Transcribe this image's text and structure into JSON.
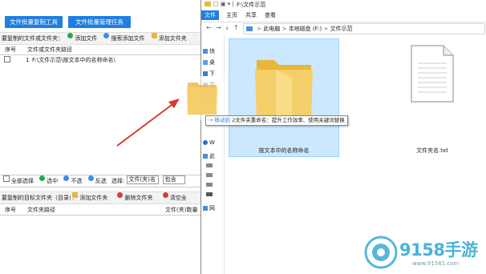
{
  "left_app": {
    "title_fragment": "",
    "top_buttons": [
      "文件批量复制工具",
      "文件批量管理任务"
    ],
    "source_toolbar": {
      "label": "要复制的文件或文件夹：",
      "add_file": "添加文件",
      "search_add_file": "搜索添加文件",
      "add_folder": "添加文件夹",
      "cut": "×"
    },
    "source_table": {
      "headers": [
        "序号",
        "文件或文件夹路径"
      ],
      "rows": [
        {
          "index": "1",
          "path": "F:\\文件示范\\按文本中的名称命名\\"
        }
      ]
    },
    "select_toolbar": {
      "select_all": "全部选择",
      "select": "选中",
      "deselect": "不选",
      "invert": "反选",
      "select_label": "选择:",
      "type_value": "文件(夹)名",
      "contains_value": "包含"
    },
    "target_toolbar": {
      "label": "要复制的目标文件夹（目录）：",
      "add_folder": "添加文件夹",
      "delete_folder": "删除文件夹",
      "clear": "清空全"
    },
    "target_table": {
      "headers": [
        "序号",
        "文件夹路径",
        "文件(夹)数量"
      ]
    }
  },
  "explorer": {
    "title": "F:\\文件示范",
    "menu": [
      "文件",
      "主页",
      "共享",
      "查看"
    ],
    "breadcrumb": [
      "此电脑",
      "本地磁盘 (F:)",
      "文件示范"
    ],
    "sidebar": [
      "快",
      "桌",
      "下",
      "文",
      "图",
      "W",
      "此",
      "网"
    ],
    "items": [
      {
        "name": "按文本中的名称命名",
        "kind": "folder",
        "selected": true
      },
      {
        "name": "文件夹名.txt",
        "kind": "text-file",
        "selected": false
      }
    ],
    "drag_tooltip": {
      "prefix": "→ 移动到",
      "text": "2文件夹重命名：提升工作效率、使用关键词替换"
    }
  },
  "watermark": {
    "brand": "9158手游",
    "domain": "www.91581.com"
  },
  "colors": {
    "accent_blue": "#1e7fe0",
    "selection_bg": "#cce8ff",
    "folder_yellow": "#f5cf6a",
    "arrow_red": "#d83a2e"
  }
}
